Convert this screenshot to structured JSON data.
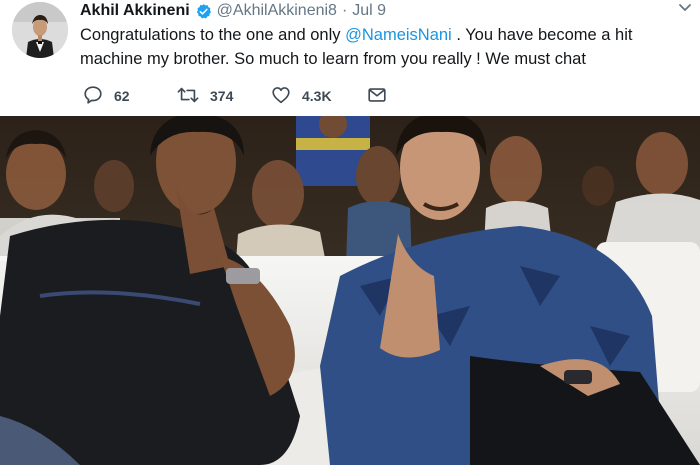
{
  "tweet": {
    "author_name": "Akhil Akkineni",
    "handle": "@AkhilAkkineni8",
    "separator": "·",
    "date": "Jul 9",
    "text_before": "Congratulations to the one and only ",
    "mention": "@NameisNani",
    "text_after": " . You have become a hit machine my brother. So much to learn from you really ! We must chat"
  },
  "actions": {
    "replies": "62",
    "retweets": "374",
    "likes": "4.3K"
  },
  "icons": {
    "verified": "verified-badge-icon",
    "caret": "chevron-down-icon",
    "reply": "reply-icon",
    "retweet": "retweet-icon",
    "like": "heart-icon",
    "message": "direct-message-icon"
  },
  "colors": {
    "mention": "#1b95e0",
    "verified": "#1da1f2",
    "muted": "#657786"
  }
}
